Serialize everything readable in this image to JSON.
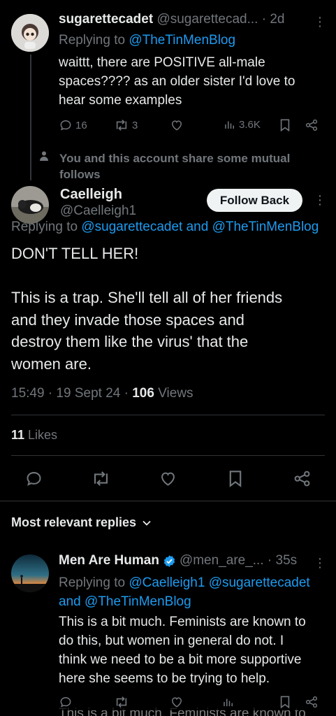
{
  "reply1": {
    "display_name": "sugarettecadet",
    "handle_time": "@sugarettecad... · 2d",
    "replying_prefix": "Replying to ",
    "replying_to": "@TheTinMenBlog",
    "text_lines": [
      "waittt, there are POSITIVE all-male",
      "spaces???? as an older sister I'd love to",
      "hear some examples"
    ],
    "replies": "16",
    "reposts": "3",
    "views": "3.6K"
  },
  "mutual_note": [
    "You and this account share some mutual",
    "follows"
  ],
  "main_post": {
    "display_name": "Caelleigh",
    "handle": "@Caelleigh1",
    "follow_label": "Follow Back",
    "replying_prefix": "Replying to ",
    "replying_to": "@sugarettecadet and @TheTinMenBlog",
    "body_lines": [
      "DON'T TELL HER!",
      "",
      "This is a trap. She'll tell all of her friends",
      "and they invade those spaces and",
      "destroy them like the virus' that the",
      "women are."
    ],
    "time": "15:49 · 19 Sept 24 · ",
    "views_count": "106",
    "views_label": " Views",
    "likes_count": "11",
    "likes_label": " Likes"
  },
  "sort": {
    "label": "Most relevant replies"
  },
  "reply2": {
    "display_name": "Men Are Human",
    "handle_time": "@men_are_... · 35s",
    "replying_prefix": "Replying to ",
    "replying_to_line1": "@Caelleigh1 @sugarettecadet",
    "replying_to_line2_prefix": "and ",
    "replying_to_line2": "@TheTinMenBlog",
    "text_lines": [
      "This is a bit much. Feminists are known to",
      "do this, but women in general do not. I",
      "think we need to be a bit more supportive",
      "here  she seems to be trying to help."
    ],
    "ghost_text": "This is a bit much. Feminists are known to"
  },
  "colors": {
    "accent": "#1d9bf0",
    "background": "#000000",
    "text": "#e7e9ea",
    "muted": "#71767b",
    "verified": "#1d9bf0"
  }
}
